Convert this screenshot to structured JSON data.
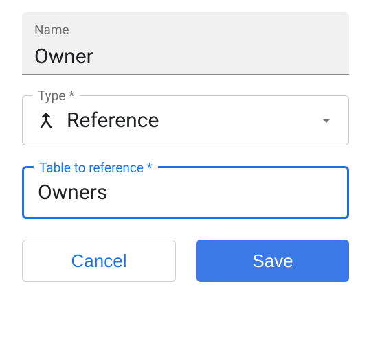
{
  "nameField": {
    "label": "Name",
    "value": "Owner"
  },
  "typeField": {
    "label": "Type *",
    "value": "Reference"
  },
  "tableField": {
    "label": "Table to reference *",
    "value": "Owners"
  },
  "buttons": {
    "cancel": "Cancel",
    "save": "Save"
  }
}
